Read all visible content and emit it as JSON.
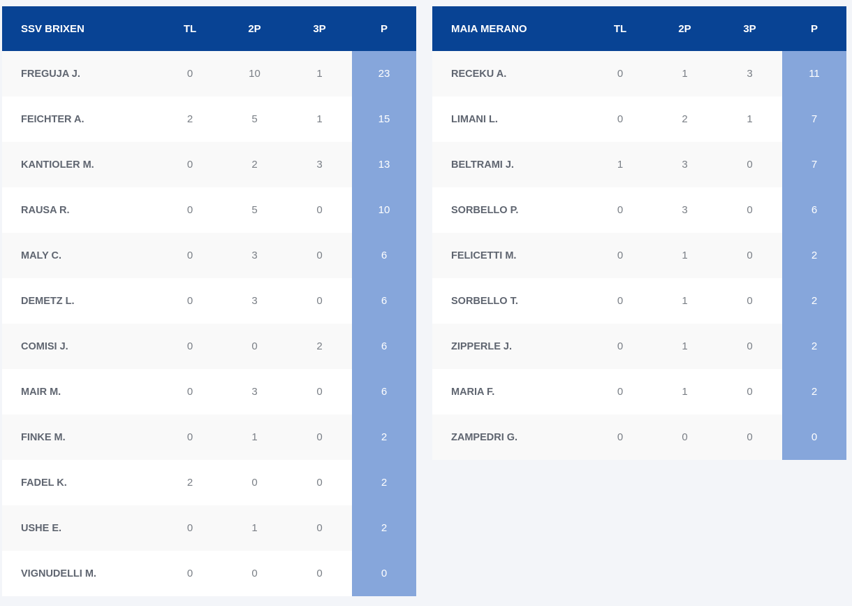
{
  "columns": {
    "tl": "TL",
    "twop": "2P",
    "threep": "3P",
    "points": "P"
  },
  "teams": [
    {
      "name": "SSV BRIXEN",
      "players": [
        {
          "name": "FREGUJA J.",
          "tl": "0",
          "twop": "10",
          "threep": "1",
          "points": "23"
        },
        {
          "name": "FEICHTER A.",
          "tl": "2",
          "twop": "5",
          "threep": "1",
          "points": "15"
        },
        {
          "name": "KANTIOLER M.",
          "tl": "0",
          "twop": "2",
          "threep": "3",
          "points": "13"
        },
        {
          "name": "RAUSA R.",
          "tl": "0",
          "twop": "5",
          "threep": "0",
          "points": "10"
        },
        {
          "name": "MALY C.",
          "tl": "0",
          "twop": "3",
          "threep": "0",
          "points": "6"
        },
        {
          "name": "DEMETZ L.",
          "tl": "0",
          "twop": "3",
          "threep": "0",
          "points": "6"
        },
        {
          "name": "COMISI J.",
          "tl": "0",
          "twop": "0",
          "threep": "2",
          "points": "6"
        },
        {
          "name": "MAIR M.",
          "tl": "0",
          "twop": "3",
          "threep": "0",
          "points": "6"
        },
        {
          "name": "FINKE M.",
          "tl": "0",
          "twop": "1",
          "threep": "0",
          "points": "2"
        },
        {
          "name": "FADEL K.",
          "tl": "2",
          "twop": "0",
          "threep": "0",
          "points": "2"
        },
        {
          "name": "USHE E.",
          "tl": "0",
          "twop": "1",
          "threep": "0",
          "points": "2"
        },
        {
          "name": "VIGNUDELLI M.",
          "tl": "0",
          "twop": "0",
          "threep": "0",
          "points": "0"
        }
      ]
    },
    {
      "name": "MAIA MERANO",
      "players": [
        {
          "name": "RECEKU A.",
          "tl": "0",
          "twop": "1",
          "threep": "3",
          "points": "11"
        },
        {
          "name": "LIMANI L.",
          "tl": "0",
          "twop": "2",
          "threep": "1",
          "points": "7"
        },
        {
          "name": "BELTRAMI J.",
          "tl": "1",
          "twop": "3",
          "threep": "0",
          "points": "7"
        },
        {
          "name": "SORBELLO P.",
          "tl": "0",
          "twop": "3",
          "threep": "0",
          "points": "6"
        },
        {
          "name": "FELICETTI M.",
          "tl": "0",
          "twop": "1",
          "threep": "0",
          "points": "2"
        },
        {
          "name": "SORBELLO T.",
          "tl": "0",
          "twop": "1",
          "threep": "0",
          "points": "2"
        },
        {
          "name": "ZIPPERLE J.",
          "tl": "0",
          "twop": "1",
          "threep": "0",
          "points": "2"
        },
        {
          "name": "MARIA F.",
          "tl": "0",
          "twop": "1",
          "threep": "0",
          "points": "2"
        },
        {
          "name": "ZAMPEDRI G.",
          "tl": "0",
          "twop": "0",
          "threep": "0",
          "points": "0"
        }
      ]
    }
  ],
  "colors": {
    "header_bg": "#084394",
    "points_col_bg": "#86a6db",
    "page_bg": "#f3f5f9"
  }
}
